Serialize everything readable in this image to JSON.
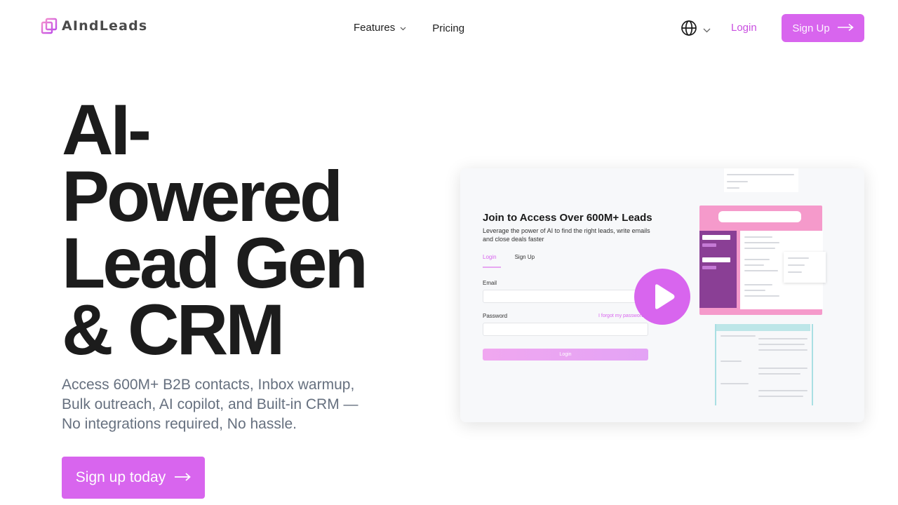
{
  "brand": {
    "name": "AIndLeads",
    "accent": "#d865ee"
  },
  "nav": {
    "features_label": "Features",
    "pricing_label": "Pricing"
  },
  "header": {
    "language_icon": "globe-icon",
    "login_label": "Login",
    "signup_label": "Sign Up"
  },
  "hero": {
    "title": "AI-Powered Lead Gen & CRM",
    "subtitle": "Access 600M+ B2B contacts, Inbox warmup, Bulk outreach, AI copilot, and Built-in CRM — No integrations required, No hassle.",
    "cta_label": "Sign up today"
  },
  "preview": {
    "heading": "Join to Access Over 600M+ Leads",
    "description": "Leverage the power of AI to find the right leads, write emails and close deals faster",
    "tab_login": "Login",
    "tab_signup": "Sign Up",
    "email_label": "Email",
    "password_label": "Password",
    "forgot_label": "I forgot my password",
    "login_button": "Login",
    "play_icon": "play-icon"
  }
}
